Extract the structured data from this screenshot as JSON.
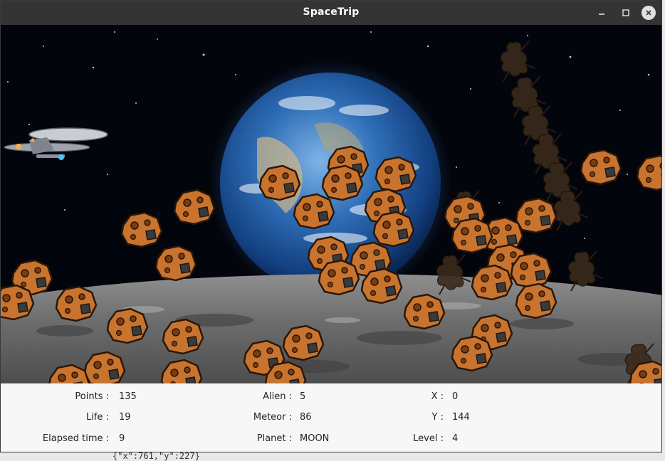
{
  "window": {
    "title": "SpaceTrip",
    "controls": [
      "minimize-icon",
      "maximize-icon",
      "close-icon"
    ]
  },
  "scene": {
    "background": "space with earth rising over lunar surface",
    "sprites": {
      "player": "spaceship-icon",
      "enemy": "alien-icon",
      "obstacle": "meteor-icon"
    }
  },
  "hud": {
    "points_label": "Points :",
    "points_value": "135",
    "life_label": "Life :",
    "life_value": "19",
    "elapsed_label": "Elapsed time :",
    "elapsed_value": "9",
    "alien_label": "Alien :",
    "alien_value": "5",
    "meteor_label": "Meteor :",
    "meteor_value": "86",
    "planet_label": "Planet :",
    "planet_value": "MOON",
    "x_label": "X :",
    "x_value": "0",
    "y_label": "Y :",
    "y_value": "144",
    "level_label": "Level :",
    "level_value": "4"
  },
  "background_app": {
    "text": "{\"x\":761,\"y\":227}"
  },
  "colors": {
    "titlebar": "#343434",
    "hud_background": "#f7f7f7",
    "meteor": "#c0682d",
    "space": "#03050c"
  }
}
